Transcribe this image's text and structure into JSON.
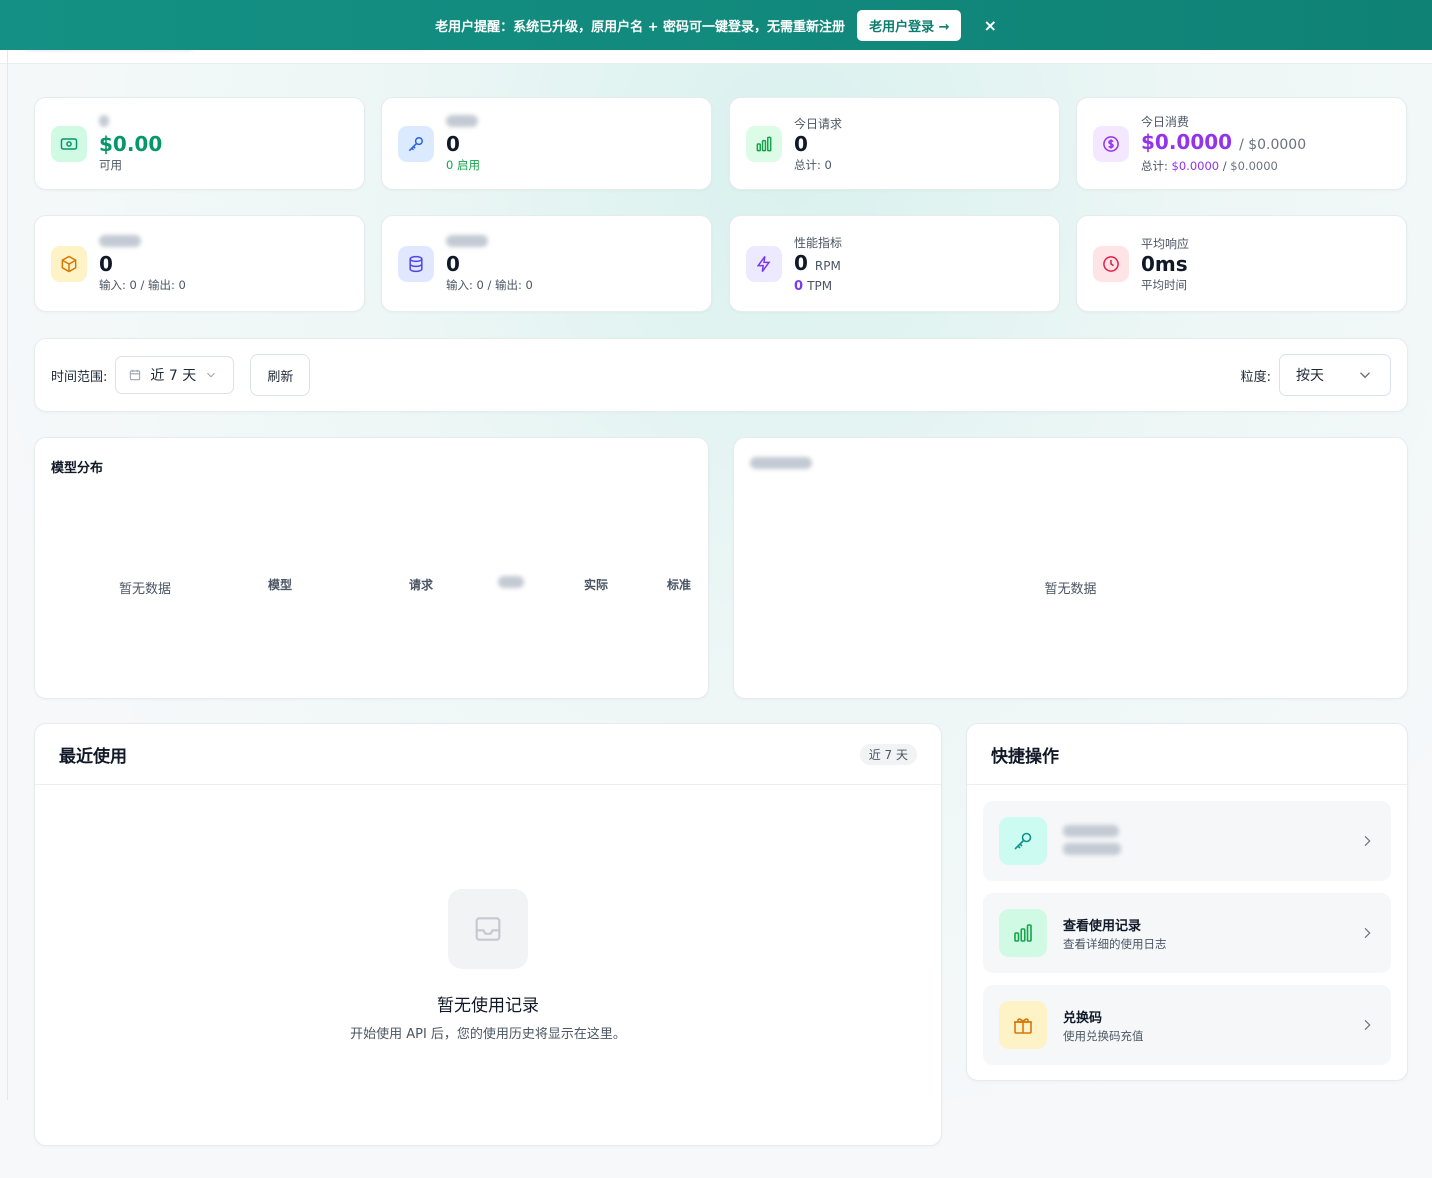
{
  "banner": {
    "message": "老用户提醒：系统已升级，原用户名 + 密码可一键登录，无需重新注册",
    "login_label": "老用户登录 →",
    "close_label": "×"
  },
  "stats_row1": [
    {
      "label": "",
      "value": "$0.00",
      "sub": "可用",
      "icon": "money-icon"
    },
    {
      "label": "",
      "value": "0",
      "sub": "0 启用",
      "icon": "key-icon"
    },
    {
      "label": "今日请求",
      "value": "0",
      "sub": "总计: 0",
      "icon": "bar-chart-icon"
    },
    {
      "label": "今日消费",
      "value": "$0.0000",
      "value_extra": "/ $0.0000",
      "sub_prefix": "总计: ",
      "sub_a": "$0.0000",
      "sub_sep": " / ",
      "sub_b": "$0.0000",
      "icon": "dollar-icon"
    }
  ],
  "stats_row2": [
    {
      "label": "",
      "value": "0",
      "sub": "输入: 0 / 输出: 0",
      "icon": "cube-icon"
    },
    {
      "label": "",
      "value": "0",
      "sub": "输入: 0 / 输出: 0",
      "icon": "database-icon"
    },
    {
      "label": "性能指标",
      "value": "0",
      "unit": "RPM",
      "value2": "0",
      "unit2": "TPM",
      "icon": "bolt-icon"
    },
    {
      "label": "平均响应",
      "value": "0ms",
      "sub": "平均时间",
      "icon": "clock-icon"
    }
  ],
  "filter": {
    "range_label": "时间范围:",
    "range_value": "近 7 天",
    "refresh_label": "刷新",
    "granularity_label": "粒度:",
    "granularity_value": "按天"
  },
  "model_panel": {
    "title": "模型分布",
    "empty": "暂无数据",
    "columns": [
      "模型",
      "请求",
      "",
      "实际",
      "标准"
    ]
  },
  "trend_panel": {
    "title": "",
    "empty": "暂无数据"
  },
  "recent": {
    "title": "最近使用",
    "badge": "近 7 天",
    "empty_title": "暂无使用记录",
    "empty_desc": "开始使用 API 后，您的使用历史将显示在这里。"
  },
  "quick": {
    "title": "快捷操作",
    "items": [
      {
        "title": "",
        "desc": "",
        "icon": "key-icon"
      },
      {
        "title": "查看使用记录",
        "desc": "查看详细的使用日志",
        "icon": "bar-chart-icon"
      },
      {
        "title": "兑换码",
        "desc": "使用兑换码充值",
        "icon": "gift-icon"
      }
    ]
  },
  "colors": {
    "brand": "#149184",
    "green": "#16a34a",
    "purple": "#9333ea",
    "orange": "#d97706",
    "red": "#e11d48"
  }
}
